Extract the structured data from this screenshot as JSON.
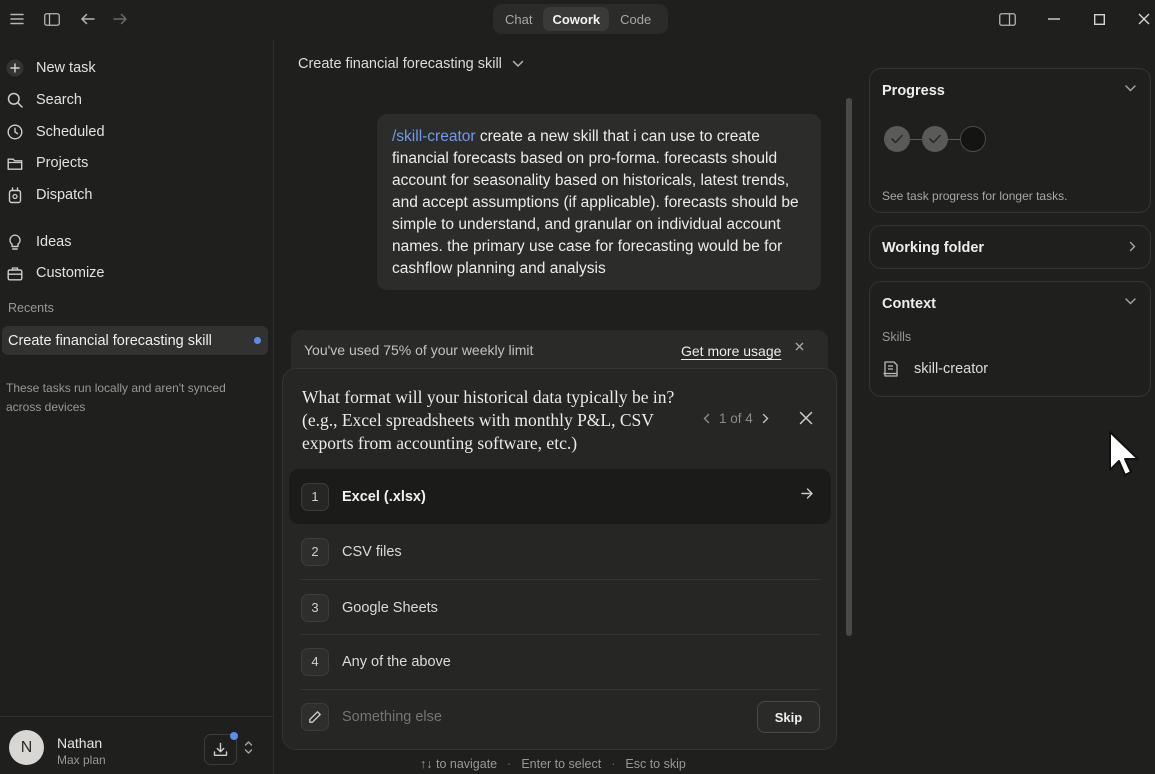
{
  "titlebar": {
    "modes": [
      {
        "label": "Chat",
        "active": false
      },
      {
        "label": "Cowork",
        "active": true
      },
      {
        "label": "Code",
        "active": false
      }
    ]
  },
  "sidebar": {
    "items": [
      {
        "label": "New task",
        "icon": "plus-icon"
      },
      {
        "label": "Search",
        "icon": "search-icon"
      },
      {
        "label": "Scheduled",
        "icon": "clock-icon"
      },
      {
        "label": "Projects",
        "icon": "folder-icon"
      },
      {
        "label": "Dispatch",
        "icon": "dispatch-icon"
      },
      {
        "label": "Ideas",
        "icon": "lightbulb-icon"
      },
      {
        "label": "Customize",
        "icon": "briefcase-icon"
      }
    ],
    "recents_label": "Recents",
    "recent_item": "Create financial forecasting skill",
    "local_note": "These tasks run locally and aren't synced across devices",
    "user": {
      "initial": "N",
      "name": "Nathan",
      "plan": "Max plan"
    }
  },
  "main": {
    "task_title": "Create financial forecasting skill",
    "message": {
      "command": "/skill-creator",
      "text": " create a new skill that i can use to create financial forecasts based on pro-forma. forecasts should account for seasonality based on historicals, latest trends, and accept assumptions (if applicable). forecasts should be simple to understand, and granular on individual account names. the primary use case for forecasting would be for cashflow planning and analysis"
    },
    "limit": {
      "text": "You've used 75% of your weekly limit",
      "link": "Get more usage"
    },
    "question": {
      "text": "What format will your historical data typically be in? (e.g., Excel spreadsheets with monthly P&L, CSV exports from accounting software, etc.)",
      "pager": "1 of 4",
      "options": [
        {
          "num": "1",
          "label": "Excel (.xlsx)"
        },
        {
          "num": "2",
          "label": "CSV files"
        },
        {
          "num": "3",
          "label": "Google Sheets"
        },
        {
          "num": "4",
          "label": "Any of the above"
        }
      ],
      "custom_placeholder": "Something else",
      "skip_label": "Skip"
    },
    "hints": {
      "navigate": "↑↓ to navigate",
      "select": "Enter to select",
      "skip": "Esc to skip"
    }
  },
  "right_panel": {
    "progress": {
      "title": "Progress",
      "steps": [
        "done",
        "done",
        "pending"
      ],
      "hint": "See task progress for longer tasks."
    },
    "working_folder": {
      "title": "Working folder"
    },
    "context": {
      "title": "Context",
      "skills_label": "Skills",
      "skill": "skill-creator"
    }
  },
  "colors": {
    "background": "#1f1f1e",
    "accent_link": "#6f9bea",
    "unread_dot": "#5b8def"
  }
}
